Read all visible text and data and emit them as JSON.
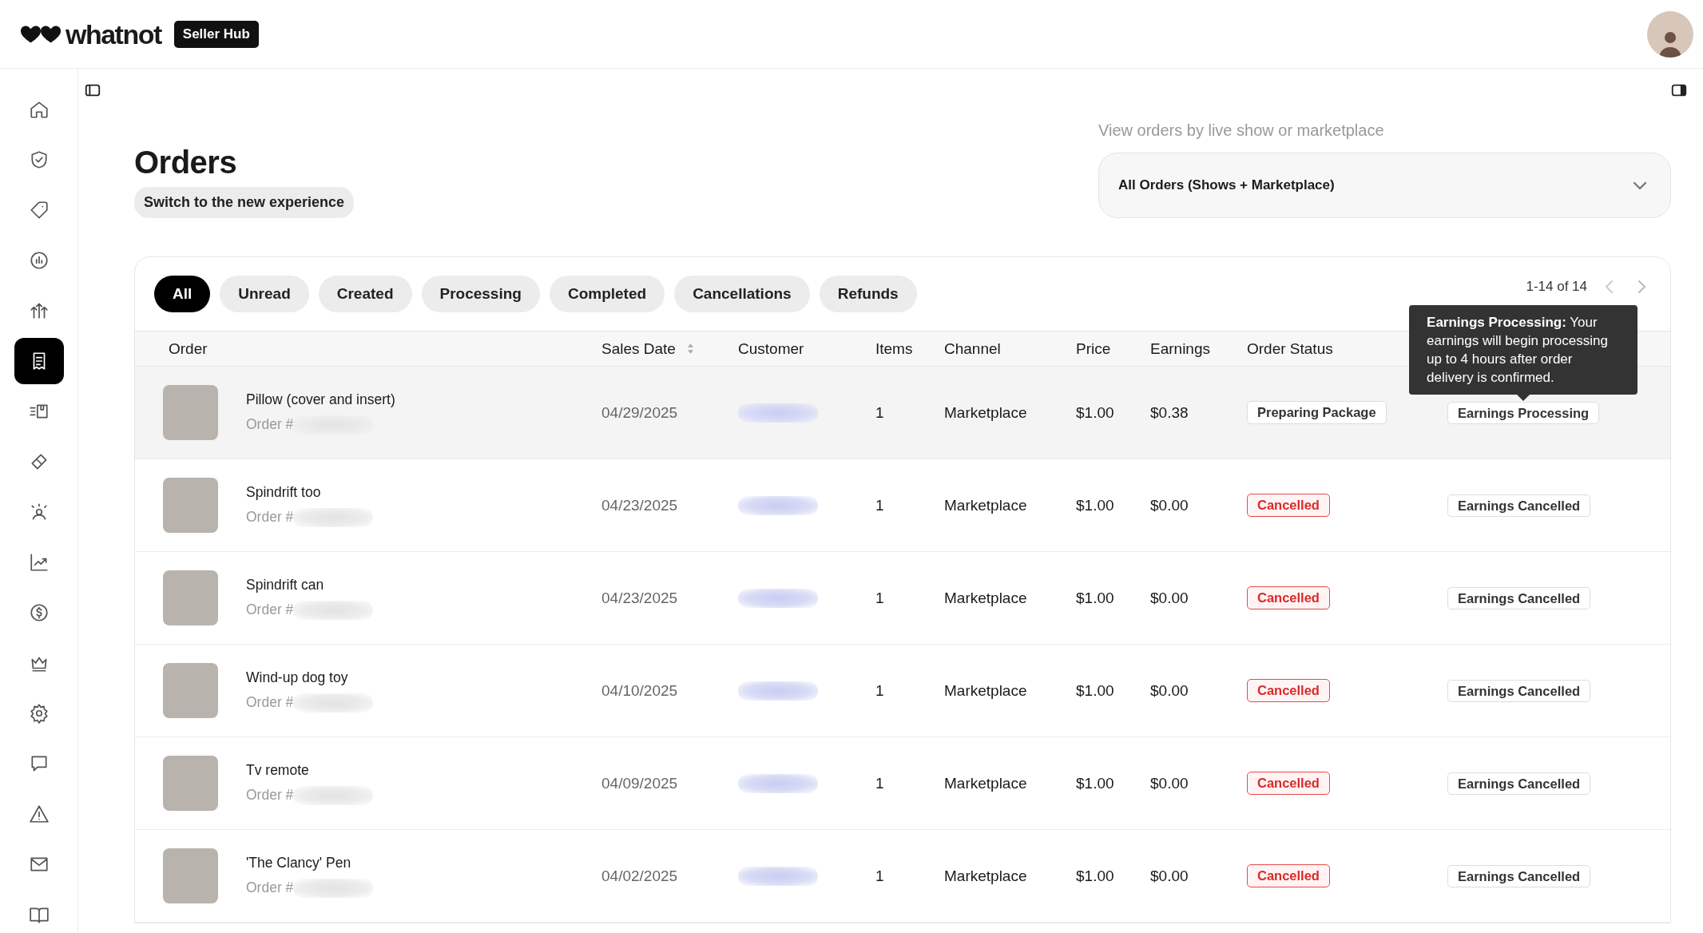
{
  "header": {
    "logo_text": "whatnot",
    "badge": "Seller Hub"
  },
  "sidebar": {
    "items": [
      {
        "kind": "home",
        "selected": false
      },
      {
        "kind": "shield",
        "selected": false
      },
      {
        "kind": "tag",
        "selected": false
      },
      {
        "kind": "gauge",
        "selected": false
      },
      {
        "kind": "arrows",
        "selected": false
      },
      {
        "kind": "receipt",
        "selected": true
      },
      {
        "kind": "shipping",
        "selected": false
      },
      {
        "kind": "bandage",
        "selected": false
      },
      {
        "kind": "people",
        "selected": false
      },
      {
        "kind": "chart",
        "selected": false
      },
      {
        "kind": "dollar",
        "selected": false
      },
      {
        "kind": "crown",
        "selected": false
      },
      {
        "kind": "gear",
        "selected": false
      },
      {
        "kind": "chat",
        "selected": false
      },
      {
        "kind": "warning",
        "selected": false
      },
      {
        "kind": "mail",
        "selected": false
      },
      {
        "kind": "book",
        "selected": false
      }
    ]
  },
  "page": {
    "title": "Orders",
    "switch_button": "Switch to the new experience"
  },
  "view_filter": {
    "label": "View orders by live show or marketplace",
    "value": "All Orders (Shows + Marketplace)"
  },
  "tabs": [
    {
      "label": "All",
      "selected": true
    },
    {
      "label": "Unread",
      "selected": false
    },
    {
      "label": "Created",
      "selected": false
    },
    {
      "label": "Processing",
      "selected": false
    },
    {
      "label": "Completed",
      "selected": false
    },
    {
      "label": "Cancellations",
      "selected": false
    },
    {
      "label": "Refunds",
      "selected": false
    }
  ],
  "pagination": {
    "text": "1-14 of 14"
  },
  "table": {
    "columns": [
      "Order",
      "Sales Date",
      "Customer",
      "Items",
      "Channel",
      "Price",
      "Earnings",
      "Order Status"
    ],
    "rows": [
      {
        "title": "Pillow (cover and insert)",
        "order_label": "Order #",
        "sales_date": "04/29/2025",
        "items": "1",
        "channel": "Marketplace",
        "price": "$1.00",
        "earnings": "$0.38",
        "order_status": {
          "text": "Preparing Package",
          "kind": "neutral"
        },
        "earnings_status": "Earnings Processing",
        "hovered": true
      },
      {
        "title": "Spindrift too",
        "order_label": "Order #",
        "sales_date": "04/23/2025",
        "items": "1",
        "channel": "Marketplace",
        "price": "$1.00",
        "earnings": "$0.00",
        "order_status": {
          "text": "Cancelled",
          "kind": "cancelled"
        },
        "earnings_status": "Earnings Cancelled",
        "hovered": false
      },
      {
        "title": "Spindrift can",
        "order_label": "Order #",
        "sales_date": "04/23/2025",
        "items": "1",
        "channel": "Marketplace",
        "price": "$1.00",
        "earnings": "$0.00",
        "order_status": {
          "text": "Cancelled",
          "kind": "cancelled"
        },
        "earnings_status": "Earnings Cancelled",
        "hovered": false
      },
      {
        "title": "Wind-up dog toy",
        "order_label": "Order #",
        "sales_date": "04/10/2025",
        "items": "1",
        "channel": "Marketplace",
        "price": "$1.00",
        "earnings": "$0.00",
        "order_status": {
          "text": "Cancelled",
          "kind": "cancelled"
        },
        "earnings_status": "Earnings Cancelled",
        "hovered": false
      },
      {
        "title": "Tv remote",
        "order_label": "Order #",
        "sales_date": "04/09/2025",
        "items": "1",
        "channel": "Marketplace",
        "price": "$1.00",
        "earnings": "$0.00",
        "order_status": {
          "text": "Cancelled",
          "kind": "cancelled"
        },
        "earnings_status": "Earnings Cancelled",
        "hovered": false
      },
      {
        "title": "'The Clancy' Pen",
        "order_label": "Order #",
        "sales_date": "04/02/2025",
        "items": "1",
        "channel": "Marketplace",
        "price": "$1.00",
        "earnings": "$0.00",
        "order_status": {
          "text": "Cancelled",
          "kind": "cancelled"
        },
        "earnings_status": "Earnings Cancelled",
        "hovered": false
      }
    ]
  },
  "tooltip": {
    "text": "**Earnings Processing:** Your earnings will begin processing up to 4 hours after order delivery is confirmed."
  }
}
